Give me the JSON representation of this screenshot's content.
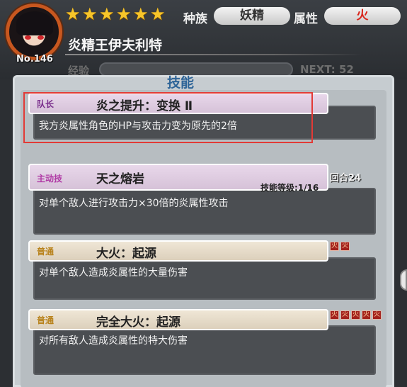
{
  "header": {
    "avatar_icon": "character-portrait-icon",
    "number": "No.146",
    "stars": [
      "★",
      "★",
      "★",
      "★",
      "★",
      "★"
    ],
    "race_label": "种族",
    "race_value": "妖精",
    "attr_label": "属性",
    "attr_value": "火",
    "name": "炎精王伊夫利特",
    "exp_label": "经验",
    "next_label": "NEXT: 52"
  },
  "panel": {
    "title": "技能"
  },
  "skills": [
    {
      "tag": "队长",
      "name": "炎之提升：变换 Ⅱ",
      "desc": "我方炎属性角色的HP与攻击力变为原先的2倍"
    },
    {
      "tag": "主动技",
      "name": "天之熔岩",
      "level": "技能等级:1/16",
      "turn": "回合24",
      "desc": "对单个敌人进行攻击力×30倍的炎属性攻击"
    },
    {
      "tag": "普通",
      "name": "大火：起源",
      "desc": "对单个敌人造成炎属性的大量伤害",
      "cost_icons": 2
    },
    {
      "tag": "普通",
      "name": "完全大火：起源",
      "desc": "对所有敌人造成炎属性的特大伤害",
      "cost_icons": 5
    }
  ],
  "colors": {
    "accent_fire": "#d9251b",
    "highlight": "#e23a36",
    "title_blue": "#2f6598"
  }
}
